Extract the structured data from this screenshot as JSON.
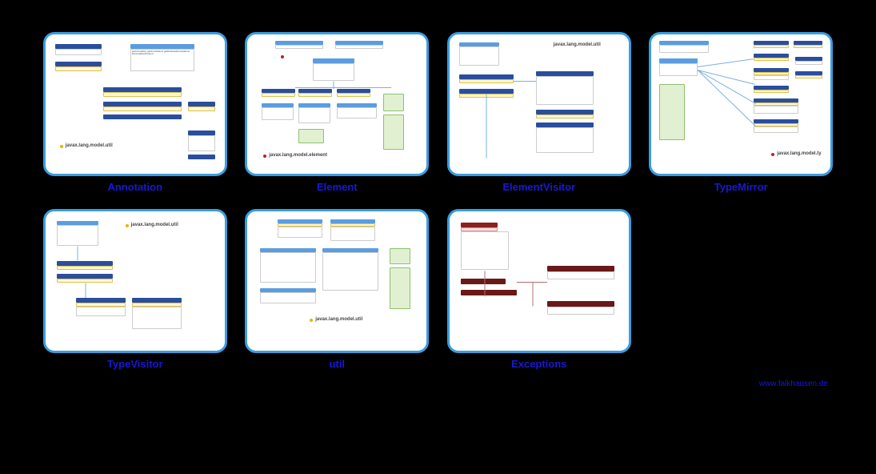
{
  "cards": [
    {
      "title": "Annotation",
      "pkg": "javax.lang.model.util"
    },
    {
      "title": "Element",
      "pkg": "javax.lang.model.element"
    },
    {
      "title": "ElementVisitor",
      "pkg": "javax.lang.model.util"
    },
    {
      "title": "TypeMirror",
      "pkg": "javax.lang.model.ty"
    },
    {
      "title": "TypeVisitor",
      "pkg": "javax.lang.model.util"
    },
    {
      "title": "util",
      "pkg": "javax.lang.model.util"
    },
    {
      "title": "Exceptions",
      "pkg": ""
    }
  ],
  "footer": "www.falkhausen.de"
}
